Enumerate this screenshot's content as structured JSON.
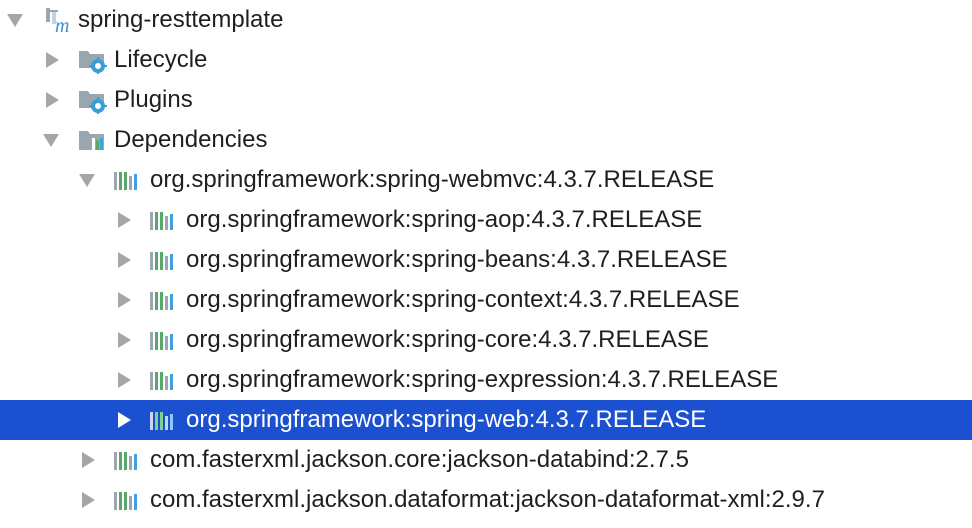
{
  "tree": {
    "root": {
      "label": "spring-resttemplate",
      "icon": "maven-module-icon",
      "expanded": true
    },
    "nodes": [
      {
        "label": "Lifecycle",
        "icon": "settings-folder-icon",
        "expanded": false
      },
      {
        "label": "Plugins",
        "icon": "settings-folder-icon",
        "expanded": false
      },
      {
        "label": "Dependencies",
        "icon": "dependencies-folder-icon",
        "expanded": true
      }
    ],
    "dependencies": [
      {
        "label": "org.springframework:spring-webmvc:4.3.7.RELEASE",
        "icon": "library-icon",
        "expanded": true
      },
      {
        "label": "org.springframework:spring-aop:4.3.7.RELEASE",
        "icon": "library-icon",
        "expanded": false
      },
      {
        "label": "org.springframework:spring-beans:4.3.7.RELEASE",
        "icon": "library-icon",
        "expanded": false
      },
      {
        "label": "org.springframework:spring-context:4.3.7.RELEASE",
        "icon": "library-icon",
        "expanded": false
      },
      {
        "label": "org.springframework:spring-core:4.3.7.RELEASE",
        "icon": "library-icon",
        "expanded": false
      },
      {
        "label": "org.springframework:spring-expression:4.3.7.RELEASE",
        "icon": "library-icon",
        "expanded": false
      },
      {
        "label": "org.springframework:spring-web:4.3.7.RELEASE",
        "icon": "library-icon",
        "expanded": false,
        "selected": true
      },
      {
        "label": "com.fasterxml.jackson.core:jackson-databind:2.7.5",
        "icon": "library-icon",
        "expanded": false
      },
      {
        "label": "com.fasterxml.jackson.dataformat:jackson-dataformat-xml:2.9.7",
        "icon": "library-icon",
        "expanded": false
      }
    ]
  },
  "colors": {
    "selection": "#1b50d0",
    "text": "#1f1f1f",
    "arrow": "#a6a6a6",
    "folder": "#9aa7b0",
    "gear": "#389fd6",
    "maven_m": "#3d8fd1",
    "lib_green": "#59a869",
    "lib_blue": "#40a0e0"
  }
}
